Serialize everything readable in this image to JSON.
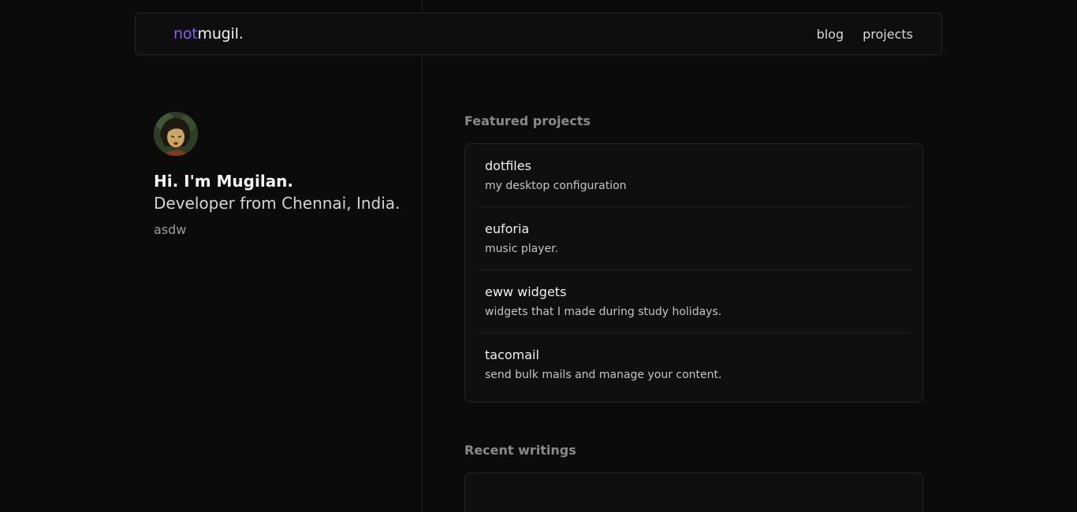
{
  "nav": {
    "logo_accent": "not",
    "logo_rest": "mugil.",
    "links": [
      "blog",
      "projects"
    ]
  },
  "intro": {
    "greeting": "Hi. I'm Mugilan.",
    "tagline": "Developer from Chennai, India.",
    "extra": "asdw"
  },
  "featured": {
    "title": "Featured projects",
    "projects": [
      {
        "name": "dotfiles",
        "description": "my desktop configuration"
      },
      {
        "name": "euforia",
        "description": "music player."
      },
      {
        "name": "eww widgets",
        "description": "widgets that I made during study holidays."
      },
      {
        "name": "tacomail",
        "description": "send bulk mails and manage your content."
      }
    ]
  },
  "writings": {
    "title": "Recent writings"
  },
  "colors": {
    "accent": "#8b5cf6",
    "background": "#0b0b0b"
  }
}
